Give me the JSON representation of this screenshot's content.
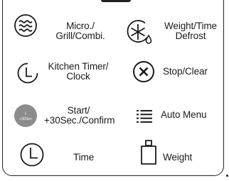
{
  "panel": {
    "buttons": [
      {
        "id": "micro-grill-combi",
        "icon": "microwave-waves-icon",
        "lines": [
          "Micro./",
          "Grill/Combi."
        ]
      },
      {
        "id": "weight-time-defrost",
        "icon": "snowflake-drop-icon",
        "lines": [
          "Weight/Time",
          "Defrost"
        ]
      },
      {
        "id": "kitchen-timer-clock",
        "icon": "timer-icon",
        "lines": [
          "Kitchen Timer/",
          "Clock"
        ]
      },
      {
        "id": "stop-clear",
        "icon": "stop-x-icon",
        "lines": [
          "Stop/Clear"
        ]
      },
      {
        "id": "start-30sec-confirm",
        "icon": "start-button-icon",
        "icon_text": [
          "I",
          "+30Sec"
        ],
        "lines": [
          "Start/",
          "+30Sec./Confirm"
        ]
      },
      {
        "id": "auto-menu",
        "icon": "list-menu-icon",
        "lines": [
          "Auto Menu"
        ]
      },
      {
        "id": "time",
        "icon": "clock-icon",
        "lines": [
          "Time"
        ]
      },
      {
        "id": "weight",
        "icon": "scale-weight-icon",
        "lines": [
          "Weight"
        ]
      }
    ]
  }
}
